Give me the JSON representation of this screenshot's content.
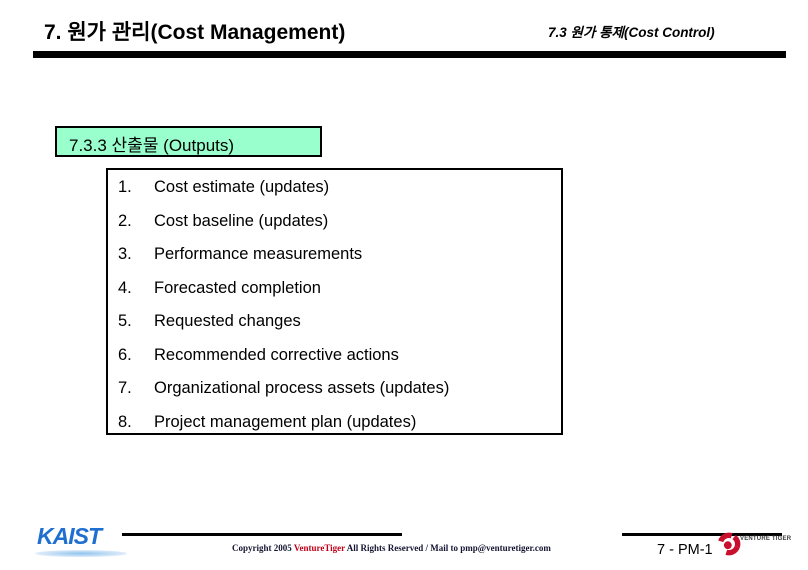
{
  "header": {
    "title": "7. 원가 관리(Cost Management)",
    "subtitle": "7.3 원가 통제(Cost Control)"
  },
  "section": {
    "heading": "7.3.3 산출물 (Outputs)",
    "heading_bg_color": "#99ffcc"
  },
  "outputs": {
    "items": [
      {
        "num": "1.",
        "text": "Cost estimate (updates)"
      },
      {
        "num": "2.",
        "text": "Cost baseline (updates)"
      },
      {
        "num": "3.",
        "text": "Performance measurements"
      },
      {
        "num": "4.",
        "text": "Forecasted completion"
      },
      {
        "num": "5.",
        "text": "Requested changes"
      },
      {
        "num": "6.",
        "text": "Recommended corrective actions"
      },
      {
        "num": "7.",
        "text": "Organizational process assets (updates)"
      },
      {
        "num": "8.",
        "text": "Project management plan (updates)"
      }
    ]
  },
  "footer": {
    "kaist_logo_text": "KAIST",
    "kaist_logo_color": "#1f6fd0",
    "copyright_prefix": "Copyright 2005 ",
    "copyright_brand": "VentureTiger",
    "copyright_middle": " All Rights Reserved / Mail to ",
    "copyright_mail": "pmp@venturetiger.com",
    "brand_color": "#c00018",
    "page_number": "7 - PM-1",
    "venturetiger_wordmark": "VENTURE TIGER",
    "venturetiger_mark_color": "#c8102e"
  }
}
